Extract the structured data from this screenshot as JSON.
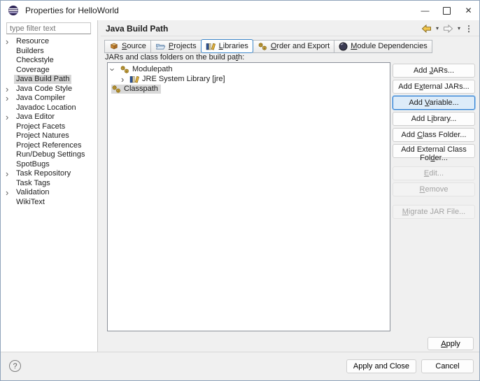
{
  "window": {
    "title": "Properties for HelloWorld"
  },
  "titlebar": {
    "minimize_glyph": "—",
    "close_glyph": "✕"
  },
  "sidebar": {
    "filter_placeholder": "type filter text",
    "items": [
      "Resource",
      "Builders",
      "Checkstyle",
      "Coverage",
      "Java Build Path",
      "Java Code Style",
      "Java Compiler",
      "Javadoc Location",
      "Java Editor",
      "Project Facets",
      "Project Natures",
      "Project References",
      "Run/Debug Settings",
      "SpotBugs",
      "Task Repository",
      "Task Tags",
      "Validation",
      "WikiText"
    ],
    "selected_item": "Java Build Path"
  },
  "header": {
    "title": "Java Build Path"
  },
  "tabs": [
    {
      "pre": "",
      "key": "S",
      "post": "ource"
    },
    {
      "pre": "",
      "key": "P",
      "post": "rojects"
    },
    {
      "pre": "",
      "key": "L",
      "post": "ibraries"
    },
    {
      "pre": "",
      "key": "O",
      "post": "rder and Export"
    },
    {
      "pre": "",
      "key": "M",
      "post": "odule Dependencies"
    }
  ],
  "selected_tab": "Libraries",
  "build_path_label": {
    "pre": "JARs and class folders on the build pa",
    "key": "t",
    "post": "h:"
  },
  "tree": {
    "modulepath": "Modulepath",
    "jre": "JRE System Library [jre]",
    "classpath": "Classpath",
    "selected_item": "Classpath"
  },
  "action_buttons": [
    {
      "pre": "Add ",
      "key": "J",
      "post": "ARs...",
      "state": "enabled"
    },
    {
      "pre": "Add E",
      "key": "x",
      "post": "ternal JARs...",
      "state": "enabled"
    },
    {
      "pre": "Add ",
      "key": "V",
      "post": "ariable...",
      "state": "focused"
    },
    {
      "pre": "Add L",
      "key": "i",
      "post": "brary...",
      "state": "enabled"
    },
    {
      "pre": "Add ",
      "key": "C",
      "post": "lass Folder...",
      "state": "enabled"
    },
    {
      "pre": "Add External Class Fol",
      "key": "d",
      "post": "er...",
      "state": "enabled"
    },
    {
      "pre": "",
      "key": "E",
      "post": "dit...",
      "state": "disabled"
    },
    {
      "pre": "",
      "key": "R",
      "post": "emove",
      "state": "disabled"
    },
    {
      "pre": "",
      "key": "M",
      "post": "igrate JAR File...",
      "state": "disabled"
    }
  ],
  "footer": {
    "apply": {
      "pre": "",
      "key": "A",
      "post": "pply"
    },
    "apply_and_close": "Apply and Close",
    "cancel": "Cancel",
    "help_glyph": "?"
  },
  "icons": {
    "chevron": "›",
    "caret_down": "▾",
    "menu_dots": "⋮"
  },
  "colors": {
    "focus_border": "#2b7cd3",
    "selection_bg": "#d9d9d9",
    "back_arrow_gold": "#f3c84e",
    "titlebar_bg": "#ffffff",
    "dialog_bg": "#f0f0f0"
  }
}
